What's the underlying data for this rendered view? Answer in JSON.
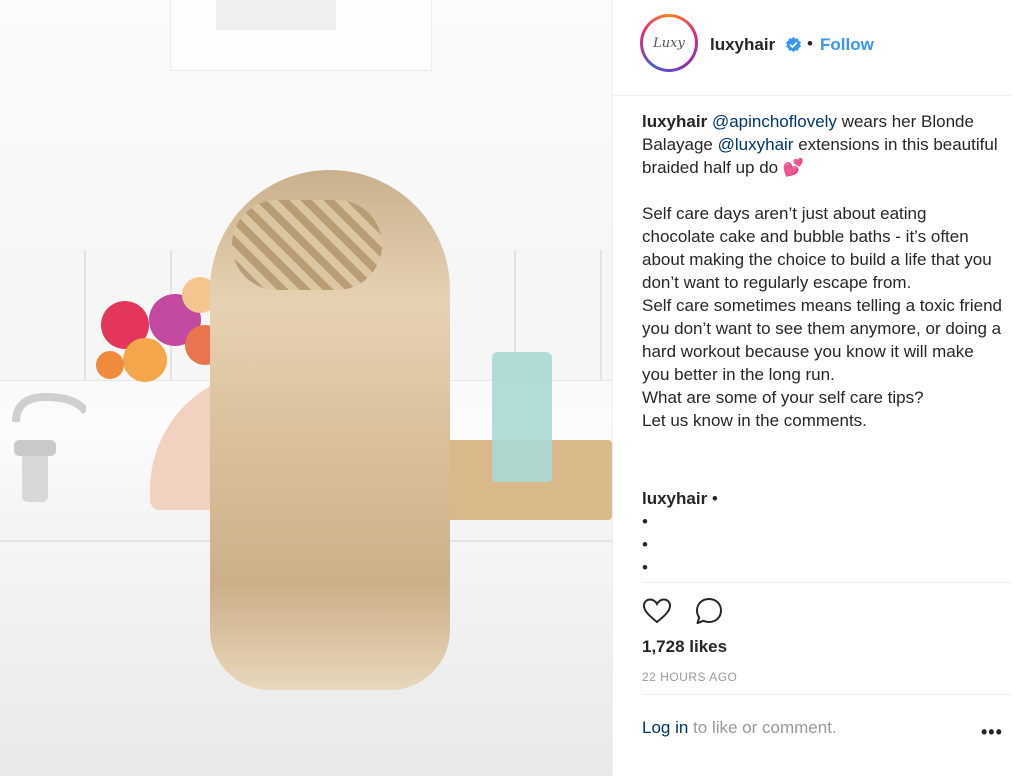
{
  "post": {
    "image_alt": "Woman with long blonde braided half-up hair sitting in a bathtub with flowers",
    "username": "luxyhair",
    "avatar_text": "Luxy",
    "separator": "•",
    "follow_label": "Follow",
    "caption": {
      "username": "luxyhair",
      "mention1": "@apinchoflovely",
      "text1": " wears her Blonde Balayage ",
      "mention2": "@luxyhair",
      "text2": " extensions in this beautiful braided half up do ",
      "emoji": "💕",
      "paragraphs": [
        "Self care days aren’t just about eating chocolate cake and bubble baths - it’s often about making the choice to build a life that you don’t want to regularly escape from.",
        "Self care sometimes means telling a toxic friend you don’t want to see them anymore, or doing a hard workout because you know it will make you better in the long run.",
        "What are some of your self care tips?",
        "Let us know in the comments."
      ]
    },
    "comment": {
      "username": "luxyhair",
      "text": " •",
      "bullets": [
        "•",
        "•",
        "•"
      ]
    },
    "likes": "1,728 likes",
    "time_ago": "22 HOURS AGO",
    "footer": {
      "login_label": "Log in",
      "rest": " to like or comment.",
      "more": "•••"
    }
  },
  "icons": {
    "like": "heart-outline-icon",
    "comment": "speech-bubble-icon",
    "verified": "verified-badge-icon",
    "more": "more-options-icon"
  },
  "colors": {
    "link_blue": "#3897f0",
    "mention_blue": "#003569",
    "meta_gray": "#999999",
    "text": "#262626"
  }
}
